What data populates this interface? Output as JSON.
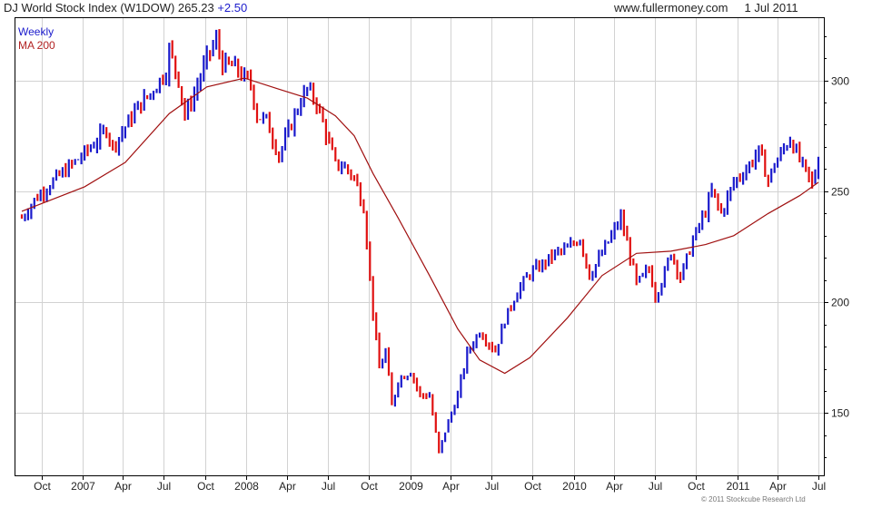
{
  "header": {
    "title": "DJ World Stock Index (W1DOW)",
    "last": "265.23",
    "change": "+2.50",
    "site": "www.fullermoney.com",
    "date": "1 Jul 2011"
  },
  "legend": {
    "series1": "Weekly",
    "series2": "MA 200"
  },
  "footer": {
    "copyright": "© 2011 Stockcube Research Ltd"
  },
  "colors": {
    "up": "#1a1acc",
    "down": "#e01010",
    "ma": "#a01010",
    "grid": "#d2d2d2"
  },
  "chart_data": {
    "type": "line",
    "title": "DJ World Stock Index (W1DOW)",
    "xlabel": "",
    "ylabel": "",
    "ylim": [
      122,
      328
    ],
    "yticks": [
      150,
      200,
      250,
      300
    ],
    "x_range": [
      "2006-08-18",
      "2011-07-01"
    ],
    "x_ticks": [
      {
        "label": "Oct",
        "date": "2006-10-01"
      },
      {
        "label": "2007",
        "date": "2007-01-01"
      },
      {
        "label": "Apr",
        "date": "2007-04-01"
      },
      {
        "label": "Jul",
        "date": "2007-07-01"
      },
      {
        "label": "Oct",
        "date": "2007-10-01"
      },
      {
        "label": "2008",
        "date": "2008-01-01"
      },
      {
        "label": "Apr",
        "date": "2008-04-01"
      },
      {
        "label": "Jul",
        "date": "2008-07-01"
      },
      {
        "label": "Oct",
        "date": "2008-10-01"
      },
      {
        "label": "2009",
        "date": "2009-01-01"
      },
      {
        "label": "Apr",
        "date": "2009-04-01"
      },
      {
        "label": "Jul",
        "date": "2009-07-01"
      },
      {
        "label": "Oct",
        "date": "2009-10-01"
      },
      {
        "label": "2010",
        "date": "2010-01-01"
      },
      {
        "label": "Apr",
        "date": "2010-04-01"
      },
      {
        "label": "Jul",
        "date": "2010-07-01"
      },
      {
        "label": "Oct",
        "date": "2010-10-01"
      },
      {
        "label": "2011",
        "date": "2011-01-01"
      },
      {
        "label": "Apr",
        "date": "2011-04-01"
      },
      {
        "label": "Jul",
        "date": "2011-07-01"
      }
    ],
    "grid": true,
    "legend_position": "top-left",
    "series": [
      {
        "name": "Weekly",
        "style": "weekly bars (blue up, red down)",
        "points": [
          [
            "2006-08-18",
            238
          ],
          [
            "2006-09-15",
            246
          ],
          [
            "2006-10-13",
            252
          ],
          [
            "2006-11-10",
            257
          ],
          [
            "2006-12-08",
            262
          ],
          [
            "2007-01-05",
            267
          ],
          [
            "2007-02-02",
            273
          ],
          [
            "2007-02-23",
            278
          ],
          [
            "2007-03-09",
            270
          ],
          [
            "2007-04-06",
            279
          ],
          [
            "2007-05-04",
            288
          ],
          [
            "2007-06-01",
            294
          ],
          [
            "2007-07-06",
            304
          ],
          [
            "2007-07-13",
            314
          ],
          [
            "2007-08-03",
            300
          ],
          [
            "2007-08-17",
            284
          ],
          [
            "2007-09-07",
            294
          ],
          [
            "2007-10-05",
            310
          ],
          [
            "2007-10-26",
            318
          ],
          [
            "2007-11-09",
            307
          ],
          [
            "2007-12-07",
            306
          ],
          [
            "2007-12-28",
            301
          ],
          [
            "2008-01-11",
            298
          ],
          [
            "2008-01-25",
            284
          ],
          [
            "2008-02-15",
            282
          ],
          [
            "2008-03-14",
            266
          ],
          [
            "2008-04-04",
            277
          ],
          [
            "2008-05-02",
            291
          ],
          [
            "2008-05-16",
            296
          ],
          [
            "2008-06-06",
            290
          ],
          [
            "2008-06-27",
            276
          ],
          [
            "2008-07-18",
            262
          ],
          [
            "2008-08-08",
            261
          ],
          [
            "2008-08-29",
            256
          ],
          [
            "2008-09-19",
            243
          ],
          [
            "2008-10-10",
            195
          ],
          [
            "2008-10-24",
            170
          ],
          [
            "2008-11-07",
            178
          ],
          [
            "2008-11-21",
            153
          ],
          [
            "2008-12-05",
            165
          ],
          [
            "2009-01-02",
            169
          ],
          [
            "2009-01-23",
            158
          ],
          [
            "2009-02-13",
            158
          ],
          [
            "2009-03-06",
            132
          ],
          [
            "2009-03-20",
            142
          ],
          [
            "2009-04-17",
            158
          ],
          [
            "2009-05-08",
            177
          ],
          [
            "2009-06-05",
            187
          ],
          [
            "2009-07-10",
            178
          ],
          [
            "2009-07-31",
            192
          ],
          [
            "2009-08-28",
            205
          ],
          [
            "2009-09-25",
            213
          ],
          [
            "2009-10-23",
            217
          ],
          [
            "2009-11-20",
            222
          ],
          [
            "2009-12-18",
            224
          ],
          [
            "2010-01-15",
            229
          ],
          [
            "2010-02-05",
            212
          ],
          [
            "2010-03-05",
            222
          ],
          [
            "2010-04-16",
            238
          ],
          [
            "2010-05-07",
            221
          ],
          [
            "2010-05-21",
            208
          ],
          [
            "2010-06-18",
            215
          ],
          [
            "2010-07-02",
            203
          ],
          [
            "2010-07-23",
            213
          ],
          [
            "2010-08-06",
            223
          ],
          [
            "2010-08-27",
            211
          ],
          [
            "2010-09-24",
            228
          ],
          [
            "2010-10-22",
            241
          ],
          [
            "2010-11-05",
            250
          ],
          [
            "2010-11-26",
            240
          ],
          [
            "2010-12-24",
            254
          ],
          [
            "2011-01-21",
            260
          ],
          [
            "2011-02-18",
            268
          ],
          [
            "2011-03-11",
            255
          ],
          [
            "2011-03-25",
            262
          ],
          [
            "2011-04-29",
            274
          ],
          [
            "2011-05-20",
            264
          ],
          [
            "2011-06-17",
            253
          ],
          [
            "2011-07-01",
            265.23
          ]
        ]
      },
      {
        "name": "MA 200",
        "style": "line",
        "points": [
          [
            "2006-08-18",
            241
          ],
          [
            "2007-01-05",
            252
          ],
          [
            "2007-04-06",
            263
          ],
          [
            "2007-07-13",
            285
          ],
          [
            "2007-10-05",
            297
          ],
          [
            "2007-12-28",
            301
          ],
          [
            "2008-03-14",
            296
          ],
          [
            "2008-05-16",
            292
          ],
          [
            "2008-07-18",
            284
          ],
          [
            "2008-08-29",
            275
          ],
          [
            "2008-10-10",
            258
          ],
          [
            "2008-12-05",
            238
          ],
          [
            "2009-02-13",
            212
          ],
          [
            "2009-04-17",
            188
          ],
          [
            "2009-06-05",
            174
          ],
          [
            "2009-07-31",
            168
          ],
          [
            "2009-09-25",
            175
          ],
          [
            "2009-12-18",
            193
          ],
          [
            "2010-03-05",
            212
          ],
          [
            "2010-05-21",
            222
          ],
          [
            "2010-08-06",
            223
          ],
          [
            "2010-10-22",
            226
          ],
          [
            "2010-12-24",
            230
          ],
          [
            "2011-03-11",
            240
          ],
          [
            "2011-05-20",
            248
          ],
          [
            "2011-07-01",
            254
          ]
        ]
      }
    ]
  }
}
